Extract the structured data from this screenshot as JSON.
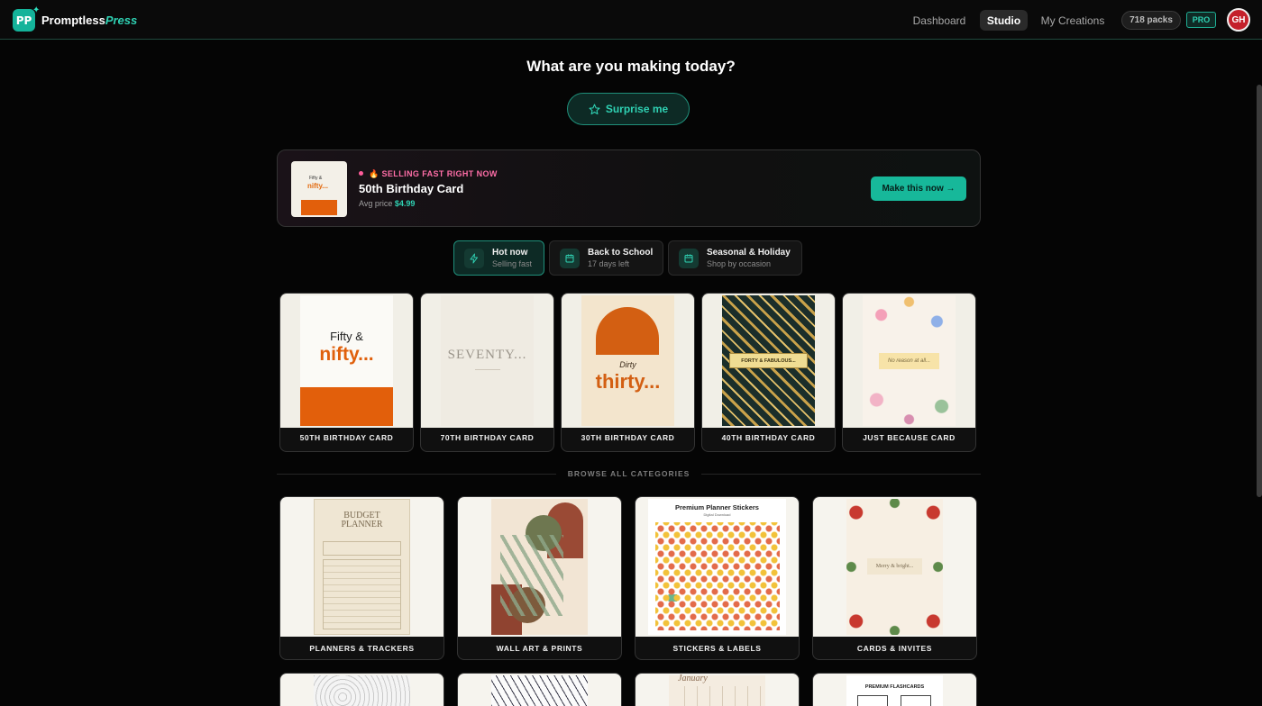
{
  "header": {
    "logo_text": "PP",
    "brand_part1": "Promptless",
    "brand_part2": "Press",
    "nav": [
      {
        "label": "Dashboard",
        "active": false
      },
      {
        "label": "Studio",
        "active": true
      },
      {
        "label": "My Creations",
        "active": false
      }
    ],
    "packs": "718 packs",
    "pro": "PRO",
    "avatar": "GH"
  },
  "main": {
    "headline": "What are you making today?",
    "surprise_label": "Surprise me"
  },
  "featured": {
    "tag": "🔥 SELLING FAST RIGHT NOW",
    "title": "50th Birthday Card",
    "price_prefix": "Avg price",
    "price": "$4.99",
    "cta": "Make this now →",
    "thumb_line1": "Fifty &",
    "thumb_line2": "nifty..."
  },
  "filters": [
    {
      "label": "Hot now",
      "sub": "Selling fast",
      "icon": "bolt-icon",
      "active": true
    },
    {
      "label": "Back to School",
      "sub": "17 days left",
      "icon": "calendar-icon",
      "active": false
    },
    {
      "label": "Seasonal & Holiday",
      "sub": "Shop by occasion",
      "icon": "calendar-icon",
      "active": false
    }
  ],
  "products": [
    {
      "name": "50TH BIRTHDAY CARD",
      "art1": "Fifty &",
      "art2": "nifty..."
    },
    {
      "name": "70TH BIRTHDAY CARD",
      "art1": "SEVENTY..."
    },
    {
      "name": "30TH BIRTHDAY CARD",
      "art1": "Dirty",
      "art2": "thirty..."
    },
    {
      "name": "40TH BIRTHDAY CARD",
      "art1": "FORTY & FABULOUS..."
    },
    {
      "name": "JUST BECAUSE CARD",
      "art1": "No reason at all..."
    }
  ],
  "browse_label": "BROWSE ALL CATEGORIES",
  "categories": [
    {
      "name": "PLANNERS & TRACKERS",
      "art1": "BUDGET",
      "art2": "PLANNER"
    },
    {
      "name": "WALL ART & PRINTS"
    },
    {
      "name": "STICKERS & LABELS",
      "art1": "Premium Planner Stickers",
      "art2": "Digital Download"
    },
    {
      "name": "CARDS & INVITES",
      "art1": "Merry & bright..."
    }
  ],
  "more_categories": {
    "calendar_art": "January",
    "flashcards_art": "PREMIUM FLASHCARDS"
  }
}
